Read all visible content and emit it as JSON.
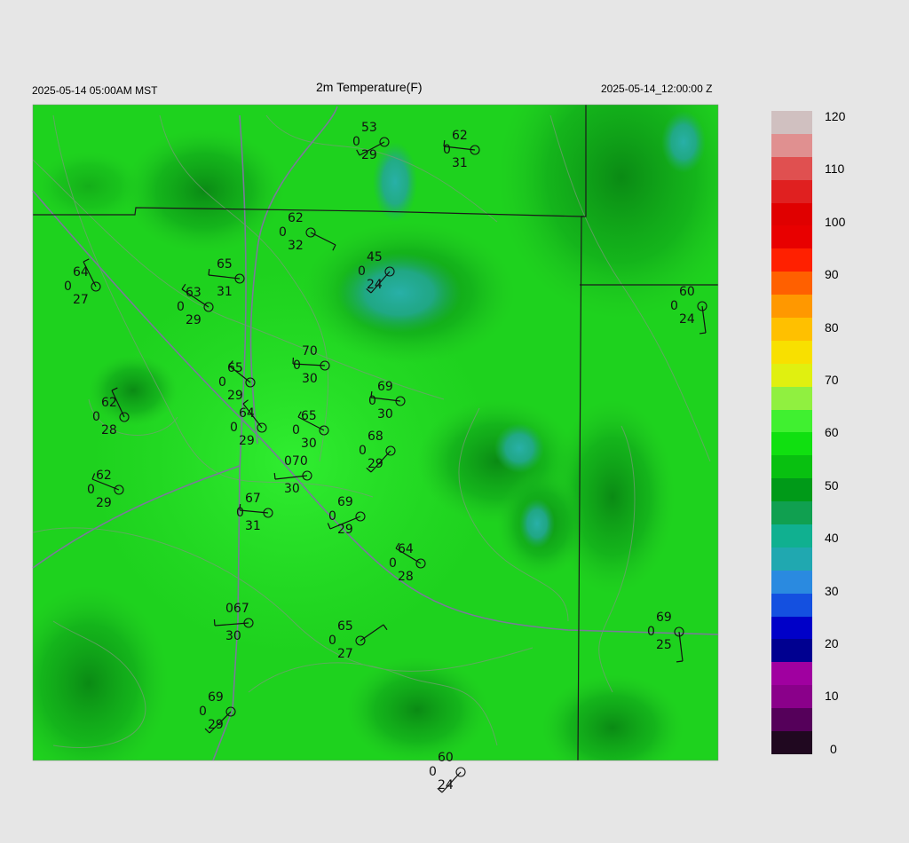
{
  "header": {
    "left": "2025-05-14 05:00AM MST",
    "title": "2m Temperature(F)",
    "right": "2025-05-14_12:00:00 Z"
  },
  "colorbar": {
    "ticks": [
      "120",
      "110",
      "100",
      "90",
      "80",
      "70",
      "60",
      "50",
      "40",
      "30",
      "20",
      "10",
      "0"
    ],
    "colors": [
      "#200820",
      "#55005a",
      "#8a008a",
      "#a000a0",
      "#000090",
      "#0000c8",
      "#1450e0",
      "#2a8ae0",
      "#20a8b0",
      "#10b090",
      "#10a050",
      "#009a18",
      "#08c010",
      "#10e010",
      "#40f030",
      "#90f040",
      "#e0f010",
      "#f8e000",
      "#ffc000",
      "#ff9800",
      "#ff6000",
      "#ff2000",
      "#e80000",
      "#e00000",
      "#e02020",
      "#e05050",
      "#e09090",
      "#d0c0c0"
    ]
  },
  "stations": [
    {
      "t": "53",
      "w": "0",
      "d": "29"
    },
    {
      "t": "62",
      "w": "0",
      "d": "31"
    },
    {
      "t": "62",
      "w": "0",
      "d": "32"
    },
    {
      "t": "45",
      "w": "0",
      "d": "24"
    },
    {
      "t": "64",
      "w": "0",
      "d": "27"
    },
    {
      "t": "65",
      "w": "",
      "d": "31"
    },
    {
      "t": "63",
      "w": "0",
      "d": "29"
    },
    {
      "t": "60",
      "w": "0",
      "d": "24"
    },
    {
      "t": "70",
      "w": "0",
      "d": "30"
    },
    {
      "t": "65",
      "w": "0",
      "d": "29"
    },
    {
      "t": "69",
      "w": "0",
      "d": "30"
    },
    {
      "t": "62",
      "w": "0",
      "d": "28"
    },
    {
      "t": "64",
      "w": "0",
      "d": "29"
    },
    {
      "t": "65",
      "w": "0",
      "d": "30"
    },
    {
      "t": "68",
      "w": "0",
      "d": "29"
    },
    {
      "t": "62",
      "w": "0",
      "d": "29"
    },
    {
      "t": "070",
      "w": "",
      "d": "30"
    },
    {
      "t": "67",
      "w": "0",
      "d": "31"
    },
    {
      "t": "69",
      "w": "0",
      "d": "29"
    },
    {
      "t": "64",
      "w": "0",
      "d": "28"
    },
    {
      "t": "067",
      "w": "",
      "d": "30"
    },
    {
      "t": "65",
      "w": "0",
      "d": "27"
    },
    {
      "t": "69",
      "w": "0",
      "d": "25"
    },
    {
      "t": "69",
      "w": "0",
      "d": "29"
    },
    {
      "t": "60",
      "w": "0",
      "d": "24"
    }
  ]
}
